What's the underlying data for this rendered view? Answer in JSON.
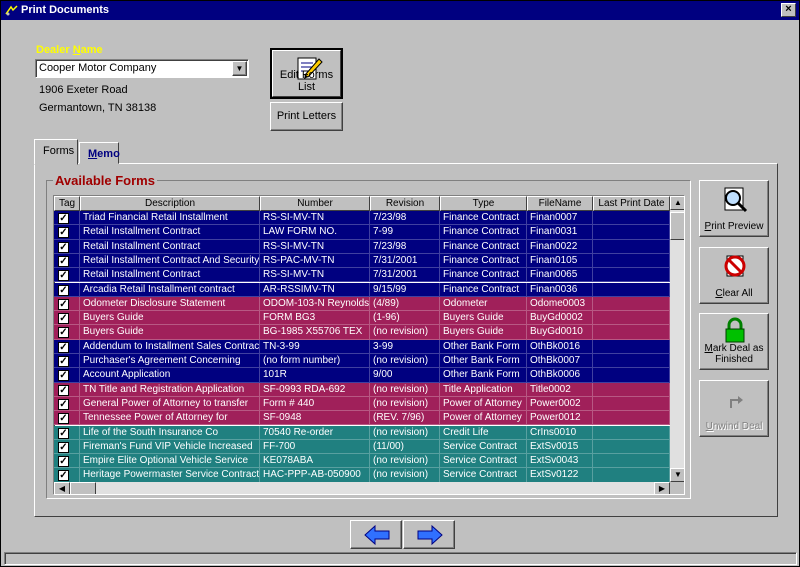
{
  "window": {
    "title": "Print Documents",
    "close_label": "×"
  },
  "dealer": {
    "label_prefix": "Dealer ",
    "label_hot": "N",
    "label_suffix": "ame",
    "selected": "Cooper Motor Company",
    "address1": "1906 Exeter Road",
    "address2": "Germantown, TN  38138"
  },
  "buttons": {
    "edit_forms": "Edit Forms List",
    "print_letters": "Print Letters",
    "print_preview_hot": "P",
    "print_preview_rest": "rint Preview",
    "clear_all_hot": "C",
    "clear_all_rest": "lear All",
    "mark_line1_hot": "M",
    "mark_line1_rest": "ark Deal as",
    "mark_line2": "Finished",
    "unwind_hot": "U",
    "unwind_rest": "nwind Deal"
  },
  "tabs": {
    "forms": "Forms",
    "memo_hot": "M",
    "memo_rest": "emo"
  },
  "group": {
    "title": "Available Forms"
  },
  "columns": [
    "Tag",
    "Description",
    "Number",
    "Revision",
    "Type",
    "FileName",
    "Last Print Date"
  ],
  "colors": {
    "finance": "#000080",
    "odometer": "#a0205a",
    "bank": "#000080",
    "title": "#a0205a",
    "service": "#208080",
    "title_yellow": "#ffff00",
    "group_red": "#a00000"
  },
  "rows": [
    {
      "desc": "Triad Financial Retail Installment",
      "num": "RS-SI-MV-TN",
      "rev": "7/23/98",
      "type": "Finance Contract",
      "file": "Finan0007",
      "date": "",
      "color": "#000080"
    },
    {
      "desc": "Retail Installment Contract",
      "num": "LAW FORM NO.",
      "rev": "7-99",
      "type": "Finance Contract",
      "file": "Finan0031",
      "date": "",
      "color": "#000080"
    },
    {
      "desc": "Retail Installment Contract",
      "num": "RS-SI-MV-TN",
      "rev": "7/23/98",
      "type": "Finance Contract",
      "file": "Finan0022",
      "date": "",
      "color": "#000080"
    },
    {
      "desc": "Retail Installment Contract And Security",
      "num": "RS-PAC-MV-TN",
      "rev": "7/31/2001",
      "type": "Finance Contract",
      "file": "Finan0105",
      "date": "",
      "color": "#000080"
    },
    {
      "desc": "Retail Installment Contract",
      "num": "RS-SI-MV-TN",
      "rev": "7/31/2001",
      "type": "Finance Contract",
      "file": "Finan0065",
      "date": "",
      "color": "#000080"
    },
    {
      "desc": "Arcadia Retail Installment contract",
      "num": "AR-RSSIMV-TN",
      "rev": "9/15/99",
      "type": "Finance Contract",
      "file": "Finan0036",
      "date": "",
      "color": "#000080"
    },
    {
      "desc": "Odometer Disclosure Statement",
      "num": "ODOM-103-N  Reynolds",
      "rev": "(4/89)",
      "type": "Odometer",
      "file": "Odome0003",
      "date": "",
      "color": "#a0205a"
    },
    {
      "desc": "Buyers Guide",
      "num": "FORM BG3",
      "rev": "(1-96)",
      "type": "Buyers Guide",
      "file": "BuyGd0002",
      "date": "",
      "color": "#a0205a"
    },
    {
      "desc": "Buyers Guide",
      "num": "BG-1985  X55706 TEX",
      "rev": "(no revision)",
      "type": "Buyers Guide",
      "file": "BuyGd0010",
      "date": "",
      "color": "#a0205a"
    },
    {
      "desc": "Addendum to Installment Sales Contract",
      "num": "TN-3-99",
      "rev": "3-99",
      "type": "Other Bank Form",
      "file": "OthBk0016",
      "date": "",
      "color": "#000080"
    },
    {
      "desc": "Purchaser's Agreement Concerning",
      "num": "(no form number)",
      "rev": "(no revision)",
      "type": "Other Bank Form",
      "file": "OthBk0007",
      "date": "",
      "color": "#000080"
    },
    {
      "desc": "Account Application",
      "num": "101R",
      "rev": "9/00",
      "type": "Other Bank Form",
      "file": "OthBk0006",
      "date": "",
      "color": "#000080"
    },
    {
      "desc": "TN Title and Registration Application",
      "num": "SF-0993  RDA-692",
      "rev": "(no revision)",
      "type": "Title Application",
      "file": "Title0002",
      "date": "",
      "color": "#a0205a"
    },
    {
      "desc": "General Power of Attorney to transfer",
      "num": "Form # 440",
      "rev": "(no revision)",
      "type": "Power of Attorney",
      "file": "Power0002",
      "date": "",
      "color": "#a0205a"
    },
    {
      "desc": "Tennessee Power of Attorney for",
      "num": "SF-0948",
      "rev": "(REV. 7/96)",
      "type": "Power of Attorney",
      "file": "Power0012",
      "date": "",
      "color": "#a0205a"
    },
    {
      "desc": "Life of the South Insurance Co",
      "num": "70540 Re-order",
      "rev": "(no revision)",
      "type": "Credit Life",
      "file": "CrIns0010",
      "date": "",
      "color": "#208080"
    },
    {
      "desc": "Fireman's Fund VIP Vehicle Increased",
      "num": "FF-700",
      "rev": "(11/00)",
      "type": "Service Contract",
      "file": "ExtSv0015",
      "date": "",
      "color": "#208080"
    },
    {
      "desc": "Empire Elite Optional Vehicle Service",
      "num": "KE078ABA",
      "rev": "(no revision)",
      "type": "Service Contract",
      "file": "ExtSv0043",
      "date": "",
      "color": "#208080"
    },
    {
      "desc": "Heritage Powermaster Service Contract",
      "num": "HAC-PPP-AB-050900",
      "rev": "(no revision)",
      "type": "Service Contract",
      "file": "ExtSv0122",
      "date": "",
      "color": "#208080"
    }
  ]
}
